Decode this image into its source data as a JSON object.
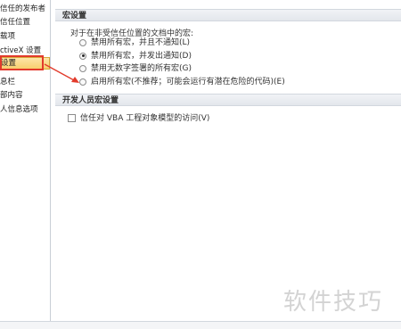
{
  "sidebar": {
    "items": [
      {
        "label": "信任的发布者"
      },
      {
        "label": "信任位置"
      },
      {
        "label": "载项"
      },
      {
        "label": "ctiveX 设置"
      },
      {
        "label": "设置"
      },
      {
        "label": "息栏"
      },
      {
        "label": "部内容"
      },
      {
        "label": "人信息选项"
      }
    ],
    "selected_index": 4
  },
  "macro_section": {
    "title": "宏设置",
    "intro": "对于在非受信任位置的文档中的宏:",
    "options": [
      {
        "label": "禁用所有宏，并且不通知(L)",
        "checked": false
      },
      {
        "label": "禁用所有宏，并发出通知(D)",
        "checked": true
      },
      {
        "label": "禁用无数字签署的所有宏(G)",
        "checked": false
      },
      {
        "label": "启用所有宏(不推荐；可能会运行有潜在危险的代码)(E)",
        "checked": false
      }
    ]
  },
  "developer_section": {
    "title": "开发人员宏设置",
    "checkbox_label": "信任对 VBA 工程对象模型的访问(V)",
    "checked": false
  },
  "watermark": "软件技巧",
  "colors": {
    "annotation": "#e23a2b",
    "selected_item": "#f8cf6e"
  }
}
